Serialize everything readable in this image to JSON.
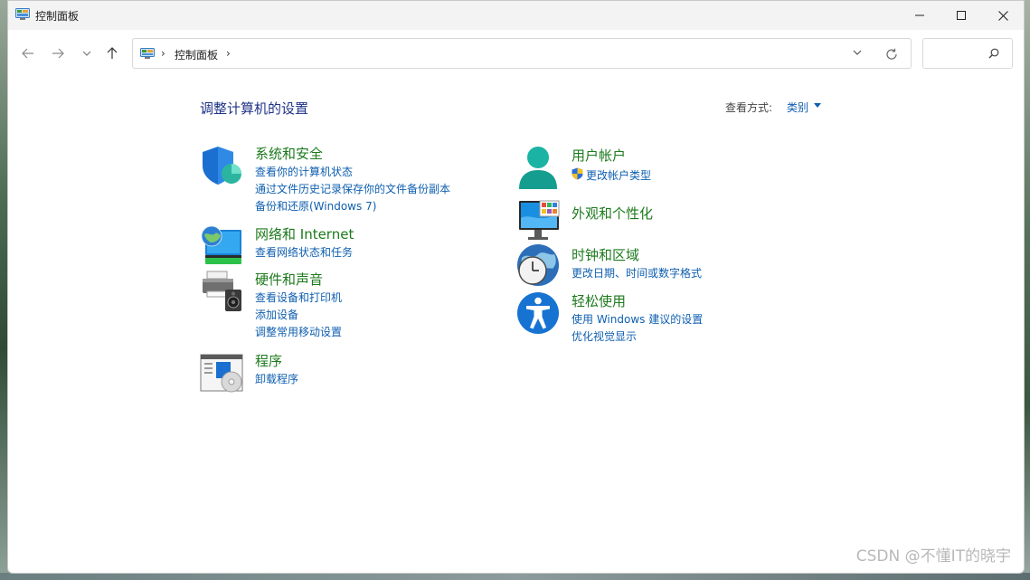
{
  "window": {
    "title": "控制面板",
    "minimize": "minimize",
    "maximize": "maximize",
    "close": "close"
  },
  "nav": {
    "breadcrumb": "控制面板",
    "search_placeholder": ""
  },
  "header": {
    "title": "调整计算机的设置",
    "view_by_label": "查看方式:",
    "view_by_value": "类别"
  },
  "categories": {
    "system_security": {
      "title": "系统和安全",
      "links": [
        "查看你的计算机状态",
        "通过文件历史记录保存你的文件备份副本",
        "备份和还原(Windows 7)"
      ]
    },
    "network": {
      "title": "网络和 Internet",
      "links": [
        "查看网络状态和任务"
      ]
    },
    "hardware": {
      "title": "硬件和声音",
      "links": [
        "查看设备和打印机",
        "添加设备",
        "调整常用移动设置"
      ]
    },
    "programs": {
      "title": "程序",
      "links": [
        "卸载程序"
      ]
    },
    "user_accounts": {
      "title": "用户帐户",
      "links": [
        "更改帐户类型"
      ]
    },
    "appearance": {
      "title": "外观和个性化",
      "links": []
    },
    "clock_region": {
      "title": "时钟和区域",
      "links": [
        "更改日期、时间或数字格式"
      ]
    },
    "ease_of_access": {
      "title": "轻松使用",
      "links": [
        "使用 Windows 建议的设置",
        "优化视觉显示"
      ]
    }
  },
  "watermark": "CSDN @不懂IT的晓宇",
  "colors": {
    "category_title": "#1c7a1c",
    "link": "#0f5fb0",
    "page_title": "#1e3287"
  }
}
